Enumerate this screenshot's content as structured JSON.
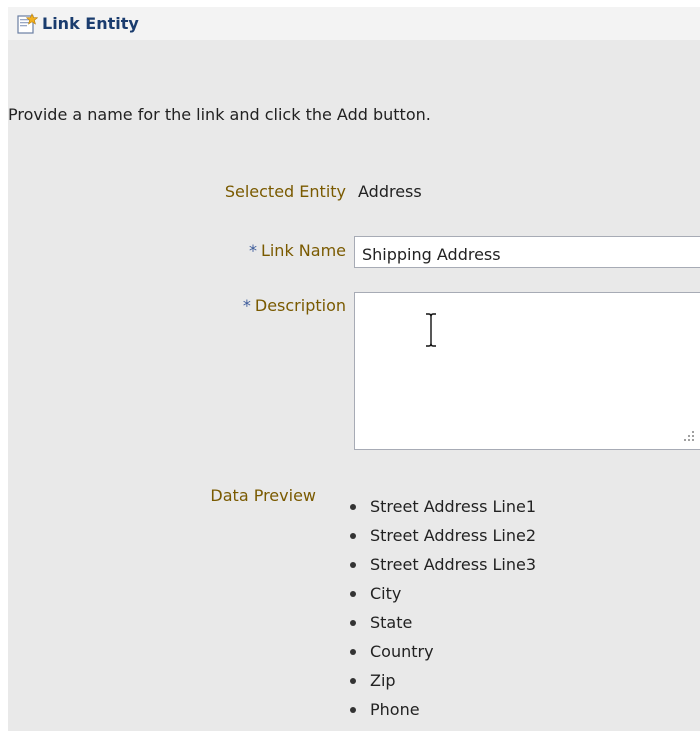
{
  "header": {
    "title": "Link Entity",
    "icon": "wizard-page-icon"
  },
  "instructions": "Provide a name for the link and click the Add button.",
  "form": {
    "selected_entity": {
      "label": "Selected Entity",
      "value": "Address"
    },
    "link_name": {
      "required_marker": "*",
      "label": "Link Name",
      "value": "Shipping Address"
    },
    "description": {
      "required_marker": "*",
      "label": "Description",
      "value": ""
    },
    "data_preview": {
      "label": "Data Preview",
      "items": [
        "Street Address Line1",
        "Street Address Line2",
        "Street Address Line3",
        "City",
        "State",
        "Country",
        "Zip",
        "Phone"
      ]
    }
  },
  "colors": {
    "panel_bg": "#e9e9e9",
    "header_bg": "#f3f3f3",
    "title": "#1a3c6e",
    "label": "#7a5a00",
    "required_marker": "#3b5a9a"
  }
}
